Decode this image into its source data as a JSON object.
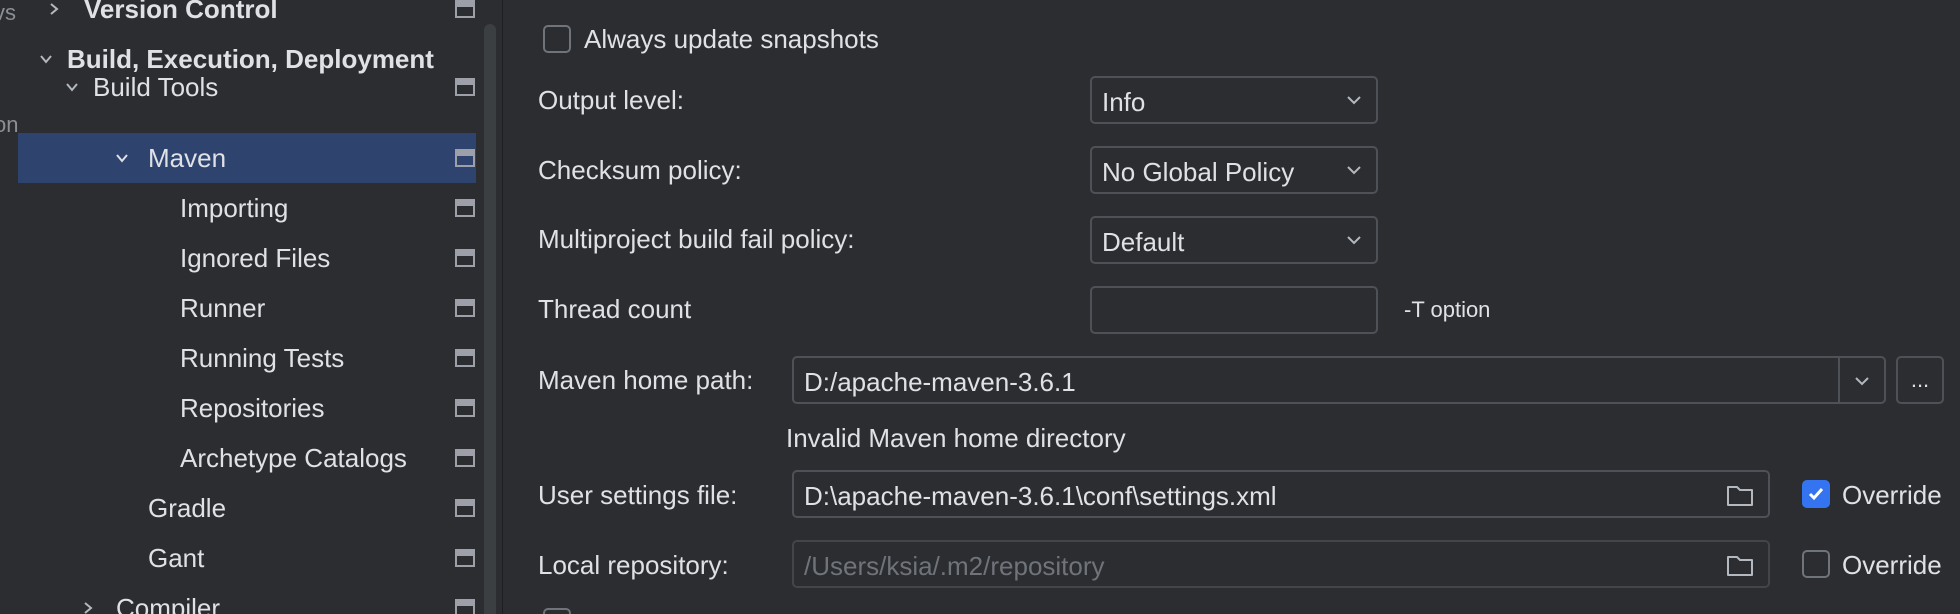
{
  "tree": {
    "edge_text_top": "vs",
    "edge_text_mid": "on",
    "items": [
      {
        "label": "Version Control",
        "bold": true
      },
      {
        "label": "Build, Execution, Deployment",
        "bold": true
      },
      {
        "label": "Build Tools",
        "bold": false
      },
      {
        "label": "Maven",
        "bold": false,
        "selected": true
      },
      {
        "label": "Importing",
        "bold": false
      },
      {
        "label": "Ignored Files",
        "bold": false
      },
      {
        "label": "Runner",
        "bold": false
      },
      {
        "label": "Running Tests",
        "bold": false
      },
      {
        "label": "Repositories",
        "bold": false
      },
      {
        "label": "Archetype Catalogs",
        "bold": false
      },
      {
        "label": "Gradle",
        "bold": false
      },
      {
        "label": "Gant",
        "bold": false
      },
      {
        "label": "Compiler",
        "bold": false
      }
    ]
  },
  "form": {
    "always_update_snapshots": {
      "label": "Always update snapshots",
      "checked": false
    },
    "output_level": {
      "label": "Output level:",
      "value": "Info"
    },
    "checksum_policy": {
      "label": "Checksum policy:",
      "value": "No Global Policy"
    },
    "multiproject_fail": {
      "label": "Multiproject build fail policy:",
      "value": "Default"
    },
    "thread_count": {
      "label": "Thread count",
      "value": "",
      "hint": "-T option"
    },
    "maven_home": {
      "label": "Maven home path:",
      "value": "D:/apache-maven-3.6.1",
      "browse_label": "...",
      "error": "Invalid Maven home directory"
    },
    "user_settings": {
      "label": "User settings file:",
      "value": "D:\\apache-maven-3.6.1\\conf\\settings.xml",
      "override_label": "Override",
      "override_checked": true
    },
    "local_repo": {
      "label": "Local repository:",
      "placeholder": "/Users/ksia/.m2/repository",
      "override_label": "Override",
      "override_checked": false
    }
  },
  "colors": {
    "background": "#2b2d30",
    "selection": "#2e436e",
    "accent": "#3574f0",
    "text": "#dfe1e5",
    "muted": "#6f737a"
  }
}
